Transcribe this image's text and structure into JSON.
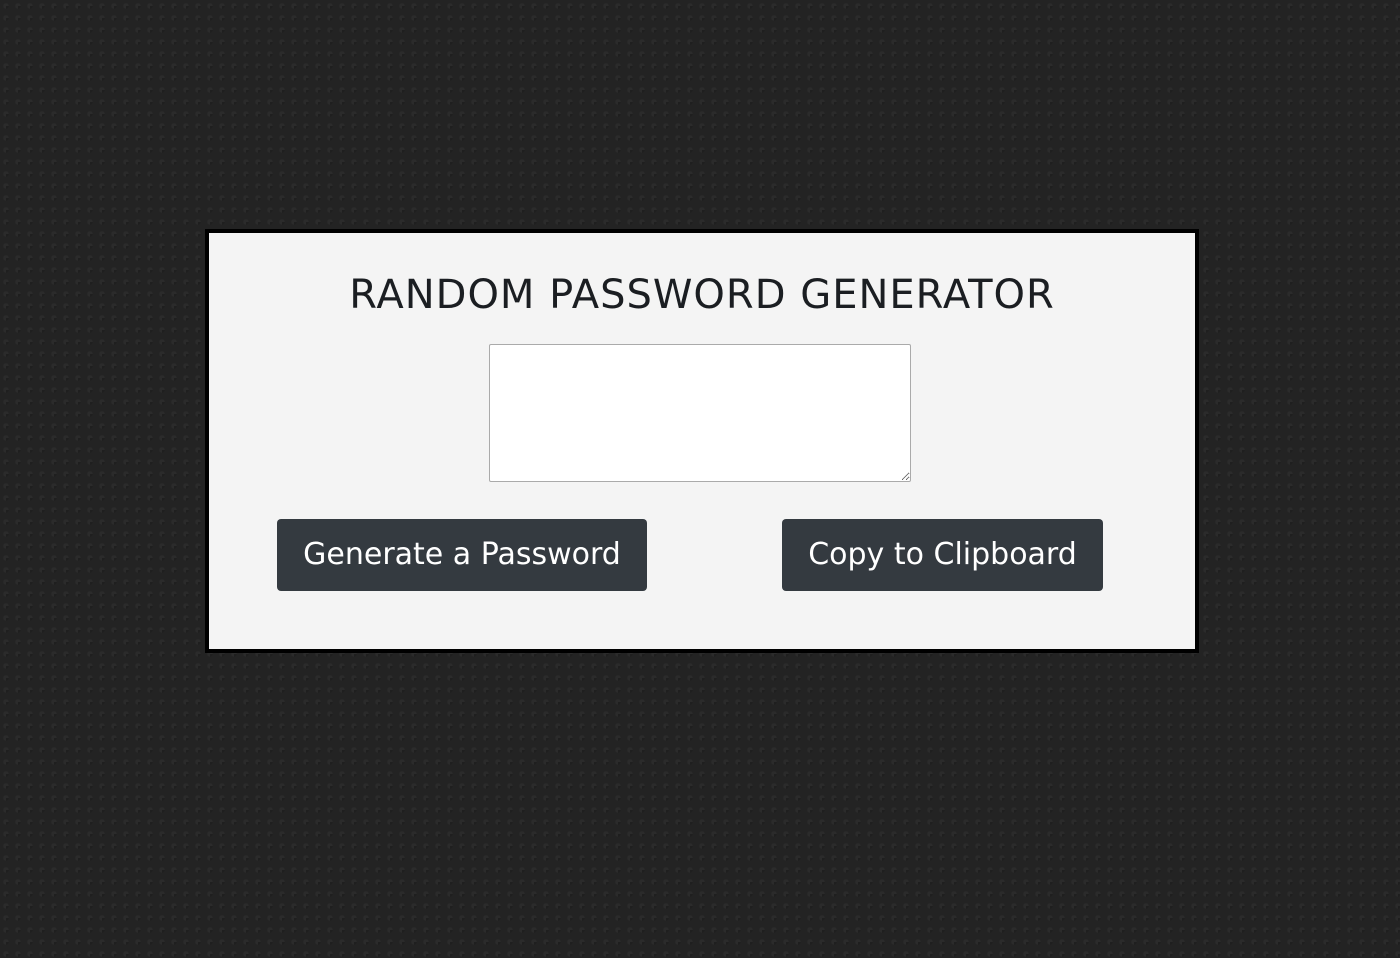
{
  "card": {
    "title": "RANDOM PASSWORD GENERATOR"
  },
  "password_output": {
    "value": "",
    "placeholder": ""
  },
  "buttons": {
    "generate_label": "Generate a Password",
    "copy_label": "Copy to Clipboard"
  },
  "colors": {
    "page_background": "#232323",
    "card_background": "#f4f4f4",
    "card_border": "#000000",
    "button_background": "#343a40",
    "button_text": "#ffffff",
    "title_text": "#1b1e22"
  }
}
